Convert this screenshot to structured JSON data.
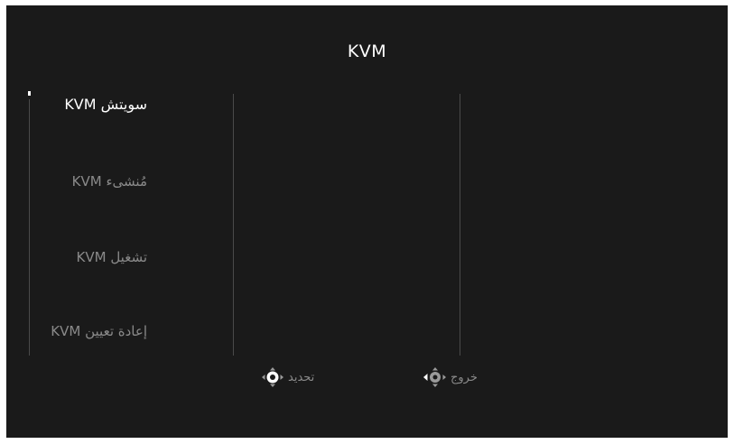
{
  "osd": {
    "title": "KVM",
    "menu": {
      "items": [
        {
          "label": "سويتش KVM",
          "state": "active"
        },
        {
          "label": "مُنشىء KVM",
          "state": "inactive"
        },
        {
          "label": "تشغيل KVM",
          "state": "inactive"
        },
        {
          "label": "إعادة تعيين KVM",
          "state": "inactive"
        }
      ]
    },
    "hints": {
      "select_label": "تحديد",
      "select_icon": "joystick-press-icon",
      "exit_label": "خروج",
      "exit_icon": "joystick-left-icon"
    },
    "colors": {
      "background": "#1a1a1a",
      "active_text": "#ffffff",
      "inactive_text": "#8a8a8a",
      "divider": "#4a4a4a"
    }
  }
}
